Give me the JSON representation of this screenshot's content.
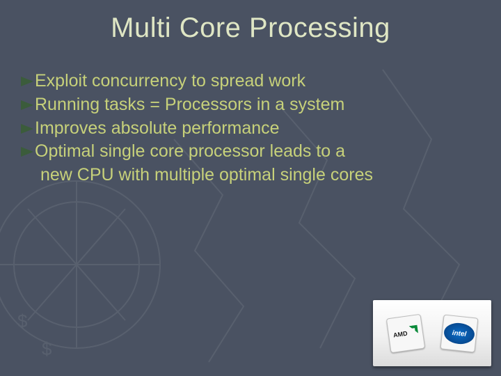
{
  "title": "Multi Core Processing",
  "bullets": [
    {
      "text": "Exploit concurrency to spread work"
    },
    {
      "text": "Running tasks = Processors in a system"
    },
    {
      "text": "Improves absolute performance"
    },
    {
      "text": "Optimal single core processor leads to a",
      "cont": "new CPU with multiple optimal single cores"
    }
  ],
  "logos": {
    "amd": "AMD",
    "intel": "intel"
  },
  "colors": {
    "arrow": "#3b5c3b"
  }
}
